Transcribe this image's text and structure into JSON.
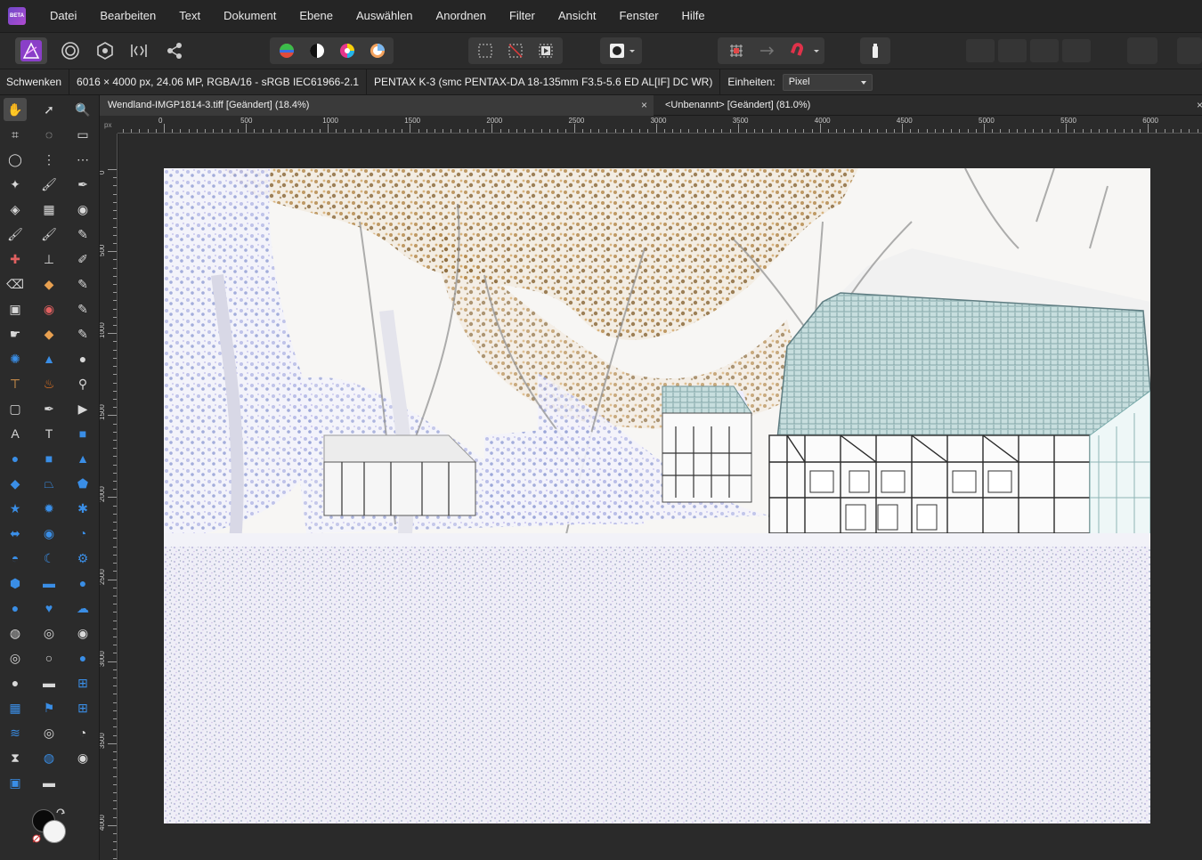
{
  "menu": {
    "logo_text": "BETA",
    "items": [
      "Datei",
      "Bearbeiten",
      "Text",
      "Dokument",
      "Ebene",
      "Auswählen",
      "Anordnen",
      "Filter",
      "Ansicht",
      "Fenster",
      "Hilfe"
    ]
  },
  "toolbar": {
    "personas": [
      "photo-persona-icon",
      "liquify-persona-icon",
      "develop-persona-icon",
      "tone-mapping-persona-icon",
      "export-persona-icon"
    ],
    "adjust": [
      "levels-icon",
      "auto-contrast-icon",
      "auto-colour-icon",
      "white-balance-icon"
    ],
    "selection": [
      "marquee-select-icon",
      "deselect-icon",
      "invert-selection-icon"
    ],
    "mask_icon": "quick-mask-icon",
    "snap": [
      "grid-snap-icon",
      "assistant-icon",
      "snapping-magnet-icon"
    ],
    "arrange": [
      "move-to-front-icon",
      "move-forward-icon",
      "move-back-icon",
      "move-to-back-icon",
      "align-icon",
      "insert-icon"
    ]
  },
  "context": {
    "tool_name": "Schwenken",
    "image_info": "6016 × 4000 px, 24.06 MP, RGBA/16 - sRGB IEC61966-2.1",
    "camera_info": "PENTAX K-3 (smc PENTAX-DA 18-135mm F3.5-5.6 ED AL[IF] DC WR)",
    "units_label": "Einheiten:",
    "units_value": "Pixel"
  },
  "tabs": [
    {
      "label": "Wendland-IMGP1814-3.tiff [Geändert] (18.4%)",
      "active": true
    },
    {
      "label": "<Unbenannt> [Geändert] (81.0%)",
      "active": false
    }
  ],
  "tab_close": "×",
  "ruler": {
    "unit": "px",
    "top_labels": [
      "0",
      "500",
      "1000",
      "1500",
      "2000",
      "2500",
      "3000",
      "3500",
      "4000",
      "4500",
      "5000",
      "5500",
      "6000"
    ],
    "left_labels": [
      "0",
      "500",
      "1000",
      "1500",
      "2000",
      "2500",
      "3000",
      "3500",
      "4000"
    ]
  },
  "tools": [
    "hand-icon",
    "move-icon",
    "zoom-icon",
    "crop-icon",
    "freehand-select-icon",
    "rectangle-marquee-icon",
    "ellipse-marquee-icon",
    "column-marquee-icon",
    "row-marquee-icon",
    "magic-wand-icon",
    "selection-brush-icon",
    "colour-picker-icon",
    "flood-fill-icon",
    "gradient-icon",
    "colour-wheel-icon",
    "paint-brush-icon",
    "colour-replacement-icon",
    "pixel-brush-icon",
    "healing-brush-icon",
    "clone-stamp-icon",
    "undo-brush-icon",
    "erase-brush-icon",
    "patch-icon",
    "background-erase-icon",
    "inpainting-icon",
    "red-eye-icon",
    "mixer-brush-icon",
    "smudge-icon",
    "flood-select-icon",
    "blemish-icon",
    "dodge-icon",
    "sharpen-icon",
    "blur-icon",
    "burn-icon",
    "fire-icon",
    "zoom-lens-icon",
    "vector-crop-icon",
    "pen-icon",
    "node-icon",
    "artistic-text-icon",
    "frame-text-icon",
    "rectangle-shape-icon",
    "ellipse-shape-icon",
    "rounded-rect-icon",
    "triangle-icon",
    "diamond-icon",
    "trapezoid-icon",
    "pentagon-icon",
    "star-icon",
    "burst-icon",
    "cog-shape-icon",
    "double-arrow-icon",
    "donut-icon",
    "pie-icon",
    "segment-icon",
    "crescent-icon",
    "gear-icon",
    "heptagon-icon",
    "callout-rect-icon",
    "callout-ellipse-icon",
    "tear-icon",
    "heart-icon",
    "cloud-icon",
    "twirl-icon",
    "pinch-icon",
    "sphere-icon",
    "ripple-icon",
    "ring-icon",
    "droplet-icon",
    "vortex-icon",
    "cylinder-icon",
    "perspective-icon",
    "mesh-warp-icon",
    "flag-icon",
    "grid-warp-icon",
    "wave-icon",
    "spiral-icon",
    "twirl-alt-icon",
    "hourglass-icon",
    "globe-icon",
    "lens-icon",
    "frame-icon",
    "shadow-icon"
  ],
  "colors": {
    "primary": "#0a0a0a",
    "secondary": "#f4f4f4"
  }
}
